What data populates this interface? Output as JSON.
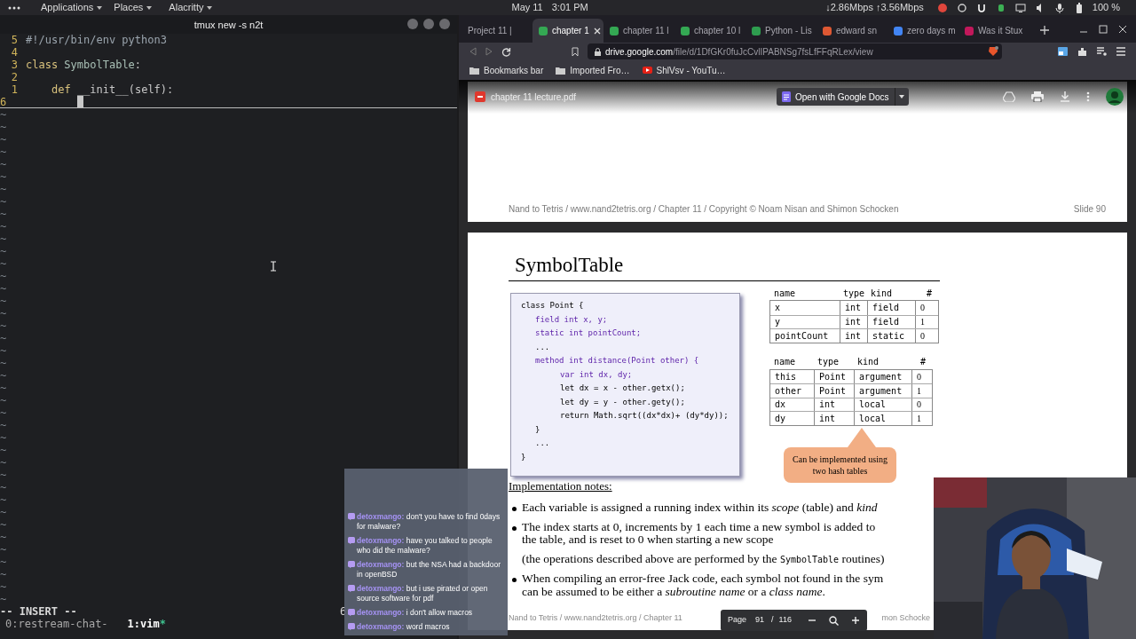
{
  "top_bar": {
    "menus": [
      {
        "label": "Applications"
      },
      {
        "label": "Places"
      },
      {
        "label": "Alacritty"
      }
    ],
    "date": "May 11",
    "time": "3:01 PM",
    "network": "↓2.86Mbps ↑3.56Mbps",
    "battery": "100 %"
  },
  "terminal": {
    "title": "tmux new -s n2t",
    "lines": [
      {
        "number": "5",
        "current": false,
        "kind": "top",
        "tokens": [
          {
            "kind": "comment",
            "text": "#!/usr/bin/env python3"
          }
        ]
      },
      {
        "number": "4",
        "current": false
      },
      {
        "number": "3",
        "current": false,
        "kind": "top",
        "tokens": [
          {
            "kind": "keyword",
            "text": "class "
          },
          {
            "kind": "name",
            "text": "SymbolTable"
          },
          {
            "kind": "plain",
            "text": ":"
          }
        ]
      },
      {
        "number": "2",
        "current": false
      },
      {
        "number": "1",
        "current": false,
        "kind": "nested",
        "tokens": [
          {
            "kind": "keyword",
            "text": "def "
          },
          {
            "kind": "plain",
            "text": "__init__(self):"
          }
        ]
      },
      {
        "number": "6",
        "current": true
      }
    ],
    "empty_lines": [
      "~",
      "~",
      "~",
      "~",
      "~",
      "~",
      "~",
      "~",
      "~",
      "~",
      "~",
      "~",
      "~",
      "~",
      "~",
      "~",
      "~",
      "~",
      "~",
      "~",
      "~",
      "~",
      "~",
      "~",
      "~",
      "~",
      "~",
      "~",
      "~",
      "~",
      "~",
      "~",
      "~",
      "~",
      "~",
      "~",
      "~",
      "~",
      "~",
      "~"
    ],
    "mode": "-- INSERT --",
    "ruler": "6",
    "tmux_windows": [
      {
        "label": "0:restream-chat-",
        "selected": false
      },
      {
        "label": "1:vim",
        "flag": "*",
        "selected": true
      }
    ]
  },
  "browser": {
    "tabs": [
      {
        "title": "Project 11 |",
        "selected": false
      },
      {
        "title": "chapter 1",
        "selected": true,
        "color": "#34a853"
      },
      {
        "title": "chapter 11 l",
        "selected": false,
        "color": "#34a853"
      },
      {
        "title": "chapter 10 l",
        "selected": false,
        "color": "#34a853"
      },
      {
        "title": "Python - Lis",
        "selected": false,
        "color": "#2e9d4f"
      },
      {
        "title": "edward sn",
        "selected": false,
        "color": "#de5833"
      },
      {
        "title": "zero days m",
        "selected": false,
        "color": "#4285f4"
      },
      {
        "title": "Was it Stux",
        "selected": false,
        "color": "#c2185b"
      }
    ],
    "url_host": "drive.google.com",
    "url_path": "/file/d/1DfGKr0fuJcCvlIPABNSg7fsLfFFqRLex/view",
    "bookmarks": [
      {
        "label": "Bookmarks bar",
        "kind": "folder"
      },
      {
        "label": "Imported Fro…",
        "kind": "folder"
      },
      {
        "label": "ShlVsv - YouTu…",
        "kind": "video"
      }
    ]
  },
  "pdf_viewer": {
    "file_name": "chapter 11 lecture.pdf",
    "open_button": "Open with Google Docs",
    "previous_page": {
      "footer": "Nand to Tetris / www.nand2tetris.org / Chapter 11 / Copyright © Noam Nisan and Shimon Schocken",
      "slide_number": "Slide 90"
    },
    "slide": {
      "title": "SymbolTable",
      "code": [
        {
          "text": "class Point {",
          "kind": "plain",
          "children": [
            {
              "text": "field int x, y;",
              "kind": "declaration"
            },
            {
              "text": "static int pointCount;",
              "kind": "declaration"
            },
            {
              "text": "...",
              "kind": "plain"
            },
            {
              "text": "method int distance(Point other) {",
              "kind": "declaration",
              "children": [
                {
                  "text": "var int dx, dy;",
                  "kind": "declaration"
                },
                {
                  "text": "let dx = x - other.getx();",
                  "kind": "plain"
                },
                {
                  "text": "let dy = y - other.gety();",
                  "kind": "plain"
                },
                {
                  "text": "return Math.sqrt((dx*dx)+ (dy*dy));",
                  "kind": "plain"
                }
              ]
            },
            {
              "text": "}",
              "kind": "plain"
            },
            {
              "text": "...",
              "kind": "plain"
            }
          ]
        },
        {
          "text": "}",
          "kind": "plain"
        }
      ],
      "tables": [
        {
          "columns": [
            "name",
            "type",
            "kind",
            "#"
          ],
          "rows": [
            [
              "x",
              "int",
              "field",
              "0"
            ],
            [
              "y",
              "int",
              "field",
              "1"
            ],
            [
              "pointCount",
              "int",
              "static",
              "0"
            ]
          ]
        },
        {
          "columns": [
            "name",
            "type",
            "kind",
            "#"
          ],
          "rows": [
            [
              "this",
              "Point",
              "argument",
              "0"
            ],
            [
              "other",
              "Point",
              "argument",
              "1"
            ],
            [
              "dx",
              "int",
              "local",
              "0"
            ],
            [
              "dy",
              "int",
              "local",
              "1"
            ]
          ]
        }
      ],
      "callout": "Can be implemented using two hash tables",
      "notes_heading": "Implementation notes:",
      "notes": [
        {
          "kind": "bullet",
          "lines": [
            [
              {
                "kind": "text",
                "text": "Each variable is assigned a running index within its *scope* (table) and *kind*"
              }
            ]
          ]
        },
        {
          "kind": "bullet",
          "lines": [
            [
              {
                "kind": "text",
                "text": "The index starts at 0, increments by 1 each time a new symbol is added to"
              }
            ],
            [
              {
                "kind": "text",
                "text": "the table, and is reset to 0 when starting a new scope"
              }
            ]
          ]
        },
        {
          "kind": "plain",
          "lines": [
            [
              {
                "kind": "text",
                "text": "(the operations described above are performed by the "
              },
              {
                "kind": "code",
                "text": "SymbolTable"
              },
              {
                "kind": "text",
                "text": " routines)"
              }
            ]
          ]
        },
        {
          "kind": "bullet",
          "lines": [
            [
              {
                "kind": "text",
                "text": "When compiling an error-free Jack code, each symbol not found in the sym"
              }
            ],
            [
              {
                "kind": "text",
                "text": "can be assumed to be either a *subroutine name* or a *class name*."
              }
            ]
          ]
        }
      ],
      "footer": "Nand to Tetris / www.nand2tetris.org / Chapter 11",
      "footer_tail": "mon Schocke"
    },
    "page_controls": {
      "label": "Page",
      "current": "91",
      "separator": "/",
      "total": "116"
    }
  },
  "chat": {
    "messages": [
      {
        "user": "detoxmango:",
        "text": "don't you have to find 0days for malware?"
      },
      {
        "user": "detoxmango:",
        "text": "have you talked to people who did the malware?"
      },
      {
        "user": "detoxmango:",
        "text": "but the NSA had a backdoor in openBSD"
      },
      {
        "user": "detoxmango:",
        "text": "but i use pirated or open source software for pdf"
      },
      {
        "user": "detoxmango:",
        "text": "i don't allow macros"
      },
      {
        "user": "detoxmango:",
        "text": "word macros"
      }
    ]
  }
}
